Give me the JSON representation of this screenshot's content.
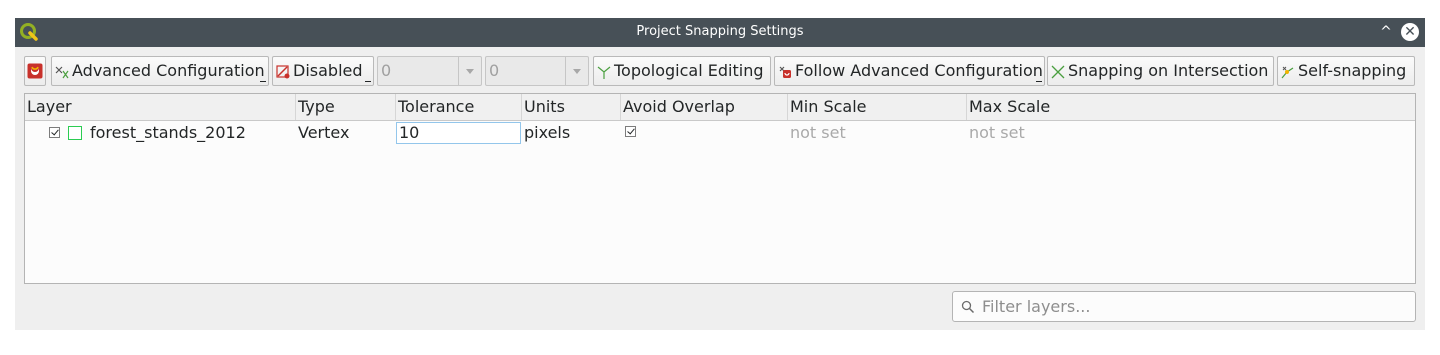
{
  "window": {
    "title": "Project Snapping Settings",
    "minimize_glyph": "^",
    "close_glyph": "✕"
  },
  "toolbar": {
    "mode_label": "Advanced Configuration",
    "type_label": "Disabled",
    "tolerance_value": "0",
    "units_value": "0",
    "topological_label": "Topological Editing",
    "follow_label": "Follow Advanced Configuration",
    "intersection_label": "Snapping on Intersection",
    "self_snapping_label": "Self-snapping"
  },
  "table": {
    "columns": [
      "Layer",
      "Type",
      "Tolerance",
      "Units",
      "Avoid Overlap",
      "Min Scale",
      "Max Scale"
    ],
    "rows": [
      {
        "layer": "forest_stands_2012",
        "type": "Vertex",
        "tolerance": "10",
        "units": "pixels",
        "min_scale": "not set",
        "max_scale": "not set"
      }
    ]
  },
  "filter": {
    "placeholder": "Filter layers..."
  },
  "colors": {
    "titlebar": "#475057",
    "layer_swatch": "#2bcc52",
    "accent_border": "#93c6eb"
  },
  "icons": [
    "qgis-logo-icon",
    "magnet-icon",
    "advanced-config-icon",
    "snapping-type-icon",
    "topological-icon",
    "follow-config-icon",
    "intersection-icon",
    "self-snapping-icon",
    "search-icon"
  ]
}
